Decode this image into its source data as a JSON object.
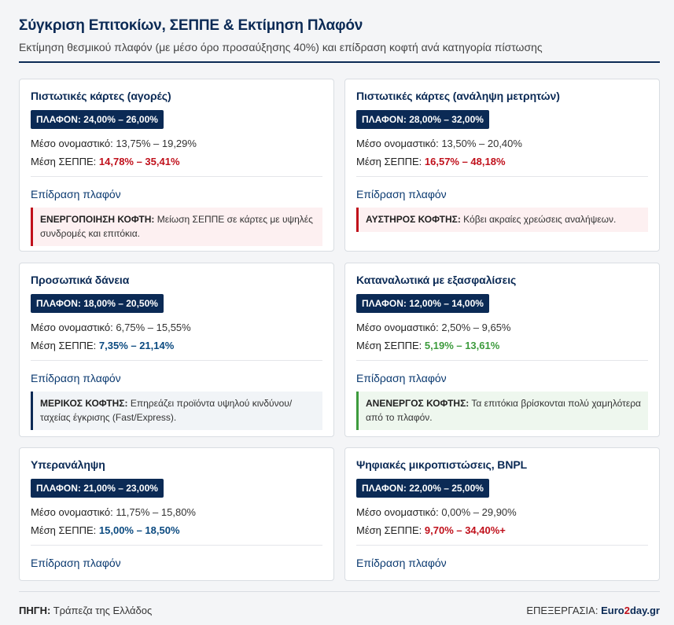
{
  "header": {
    "title": "Σύγκριση Επιτοκίων, ΣΕΠΠΕ & Εκτίμηση Πλαφόν",
    "subtitle": "Εκτίμηση θεσμικού πλαφόν (με μέσο όρο προσαύξησης 40%) και επίδραση κοφτή ανά κατηγορία πίστωσης"
  },
  "labels": {
    "nominal": "Μέσο ονομαστικό:",
    "sepe": "Μέση ΣΕΠΠΕ:",
    "impact": "Επίδραση πλαφόν"
  },
  "cards": [
    {
      "title": "Πιστωτικές κάρτες (αγορές)",
      "plafon": "ΠΛΑΦΟΝ: 24,00% – 26,00%",
      "nominal": "13,75% – 19,29%",
      "sepe": "14,78% – 35,41%",
      "status_color": "#c0101b",
      "note_label": "ΕΝΕΡΓΟΠΟΙΗΣΗ ΚΟΦΤΗ:",
      "note_text": "Μείωση ΣΕΠΠΕ σε κάρτες με υψηλές συνδρομές και επιτόκια."
    },
    {
      "title": "Πιστωτικές κάρτες (ανάληψη μετρητών)",
      "plafon": "ΠΛΑΦΟΝ: 28,00% – 32,00%",
      "nominal": "13,50% – 20,40%",
      "sepe": "16,57% – 48,18%",
      "status_color": "#c0101b",
      "note_label": "ΑΥΣΤΗΡΟΣ ΚΟΦΤΗΣ:",
      "note_text": "Κόβει ακραίες χρεώσεις αναλήψεων."
    },
    {
      "title": "Προσωπικά δάνεια",
      "plafon": "ΠΛΑΦΟΝ: 18,00% – 20,50%",
      "nominal": "6,75% – 15,55%",
      "sepe": "7,35% – 21,14%",
      "status_color": "#0b4a80",
      "note_label": "ΜΕΡΙΚΟΣ ΚΟΦΤΗΣ:",
      "note_text": "Επηρεάζει προϊόντα υψηλού κινδύνου/ταχείας έγκρισης (Fast/Express)."
    },
    {
      "title": "Καταναλωτικά με εξασφαλίσεις",
      "plafon": "ΠΛΑΦΟΝ: 12,00% – 14,00%",
      "nominal": "2,50% – 9,65%",
      "sepe": "5,19% – 13,61%",
      "status_color": "#3d9b3d",
      "note_label": "ΑΝΕΝΕΡΓΟΣ ΚΟΦΤΗΣ:",
      "note_text": "Τα επιτόκια βρίσκονται πολύ χαμηλότερα από το πλαφόν."
    },
    {
      "title": "Υπερανάληψη",
      "plafon": "ΠΛΑΦΟΝ: 21,00% – 23,00%",
      "nominal": "11,75% – 15,80%",
      "sepe": "15,00% – 18,50%",
      "status_color": "#0b4a80"
    },
    {
      "title": "Ψηφιακές μικροπιστώσεις, BNPL",
      "plafon": "ΠΛΑΦΟΝ: 22,00% – 25,00%",
      "nominal": "0,00% – 29,90%",
      "sepe": "9,70% – 34,40%+",
      "status_color": "#c0101b"
    }
  ],
  "footer": {
    "source_label": "ΠΗΓΗ:",
    "source_value": "Τράπεζα της Ελλάδος",
    "processing_label": "ΕΠΕΞΕΡΓΑΣΙΑ:",
    "brand_part1": "Euro",
    "brand_part2": "2",
    "brand_part3": "day.gr"
  }
}
